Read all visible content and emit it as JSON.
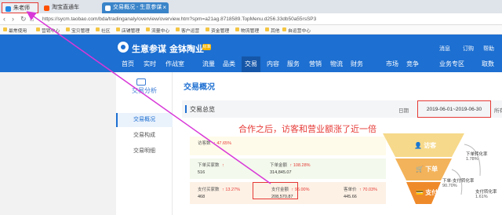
{
  "browser": {
    "tabs": [
      {
        "label": "朱老师"
      },
      {
        "label": "淘宝直通车"
      },
      {
        "label": "交易概况 - 生意参谋"
      }
    ],
    "url": "https://sycm.taobao.com/bda/tradinganaly/overview/overview.htm?spm=a21ag.8718589.TopMenu.d256.33db50a55rsSP3",
    "bookmarks": [
      "最常使用",
      "营销中心",
      "宝贝管理",
      "社区",
      "店铺管理",
      "流量中心",
      "客户运营",
      "资金管理",
      "物流管理",
      "其他",
      "自运营中心"
    ]
  },
  "header": {
    "logo": "生意参谋",
    "shop": "金钵陶业",
    "badge": "标准",
    "right_items": [
      "消息",
      "订购",
      "帮助"
    ],
    "nav": [
      "首页",
      "实时",
      "作战室",
      "流量",
      "品类",
      "交易",
      "内容",
      "服务",
      "营销",
      "物流",
      "财务",
      "市场",
      "竞争",
      "业务专区",
      "取数"
    ],
    "active_nav": "交易"
  },
  "sidebar": {
    "title": "交易分析",
    "items": [
      "交易概况",
      "交易构成",
      "交易明细"
    ],
    "active": "交易概况"
  },
  "main": {
    "page_title": "交易概况",
    "section_title": "交易总览",
    "date_label": "日期",
    "date_range": "2019-06-01~2019-06-30",
    "all_terminals": "所有终端",
    "annotation": "合作之后，访客和营业额涨了近一倍",
    "metrics": {
      "visitors": {
        "label": "访客数",
        "change": "47.65%"
      },
      "order_buyers": {
        "label": "下单买家数",
        "change": "↑",
        "value": "516"
      },
      "order_amount": {
        "label": "下单金额",
        "change": "108.28%",
        "value": "314,845.07"
      },
      "pay_buyers": {
        "label": "支付买家数",
        "change": "13.27%",
        "value": "468"
      },
      "pay_amount": {
        "label": "支付金额",
        "change": "96.00%",
        "value": "208,570.87"
      },
      "avg_price": {
        "label": "客单价",
        "change": "70.03%",
        "value": "445.66"
      }
    },
    "funnel": {
      "levels": [
        "访客",
        "下单",
        "支付"
      ],
      "conversions": [
        {
          "label": "下单转化率",
          "value": "1.78%"
        },
        {
          "label": "下单-支付转化率",
          "value": "90.70%"
        },
        {
          "label": "支付转化率",
          "value": "1.61%"
        }
      ]
    }
  },
  "colors": {
    "brand_blue": "#1d6fd1",
    "highlight_red": "#e53935",
    "arrow_magenta": "#d838d8"
  }
}
